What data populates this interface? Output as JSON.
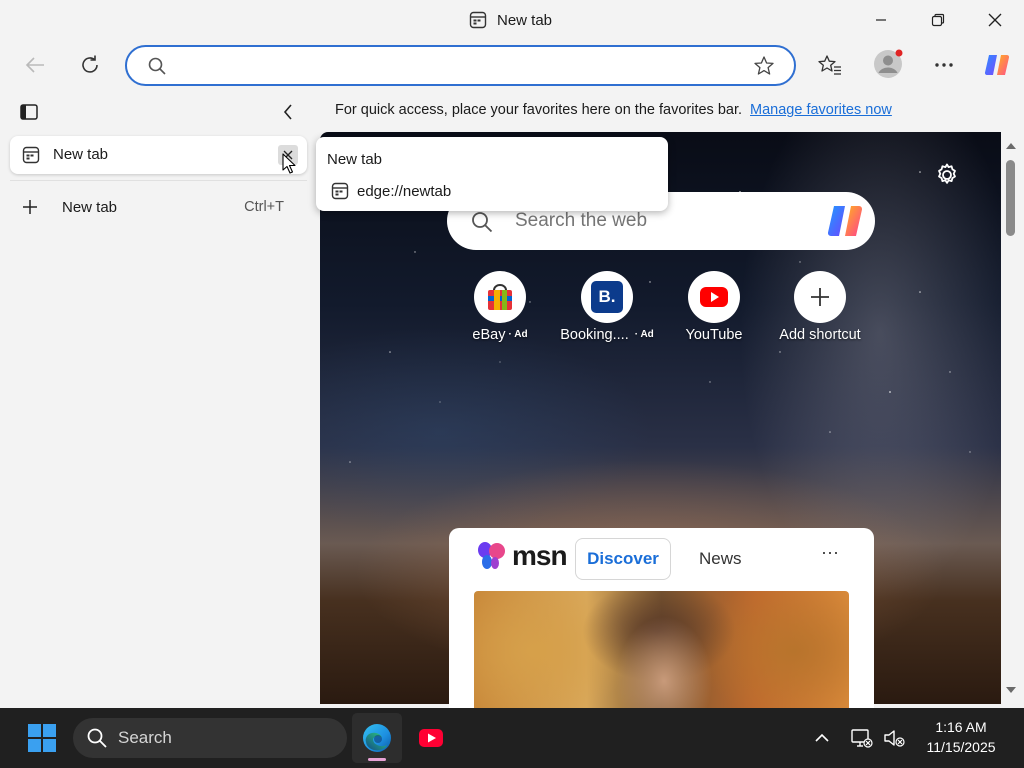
{
  "window": {
    "title": "New tab"
  },
  "toolbar": {
    "address_value": "",
    "address_placeholder": ""
  },
  "favorites_bar": {
    "message": "For quick access, place your favorites here on the favorites bar.",
    "link": "Manage favorites now"
  },
  "sidebar": {
    "tabs": [
      {
        "label": "New tab"
      }
    ],
    "new_tab": {
      "label": "New tab",
      "shortcut": "Ctrl+T"
    }
  },
  "tooltip": {
    "title": "New tab",
    "url": "edge://newtab"
  },
  "ntp": {
    "search_placeholder": "Search the web",
    "shortcuts": [
      {
        "label": "eBay",
        "ad": "· Ad",
        "icon": "ebay-bag-icon"
      },
      {
        "label": "Booking....",
        "ad": "· Ad",
        "icon": "booking-icon"
      },
      {
        "label": "YouTube",
        "ad": "",
        "icon": "youtube-icon"
      },
      {
        "label": "Add shortcut",
        "ad": "",
        "icon": "plus-icon"
      }
    ],
    "booking_letter": "B.",
    "msn": {
      "logo_text": "msn",
      "tabs": [
        "Discover",
        "News"
      ],
      "more": "···"
    }
  },
  "taskbar": {
    "search_label": "Search",
    "time": "1:16 AM",
    "date": "11/15/2025"
  },
  "colors": {
    "accent": "#2f6fd1",
    "link": "#1a6ed8",
    "youtube_red": "#ff0000",
    "taskbar": "#202020"
  }
}
